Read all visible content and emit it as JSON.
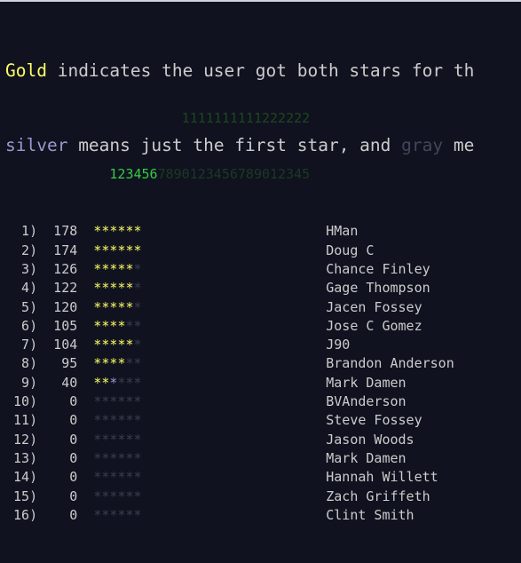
{
  "legend": {
    "line1": [
      {
        "text": "Gold",
        "style": "gold"
      },
      {
        "text": " indicates the user got both stars for th",
        "style": "plain"
      }
    ],
    "line2": [
      {
        "text": "silver",
        "style": "silver"
      },
      {
        "text": " means just the first star, and ",
        "style": "plain"
      },
      {
        "text": "gray",
        "style": "gray"
      },
      {
        "text": " me",
        "style": "plain"
      }
    ],
    "full_text_line1": "Gold indicates the user got both stars for th",
    "full_text_line2": "silver means just the first star, and gray me"
  },
  "column_header": {
    "tens_row": "         1111111111222222",
    "ones_row": "1234567890123456789012345",
    "highlight_count": 6,
    "tens_indent": 9
  },
  "colors": {
    "background": "#10121f",
    "gold": "#ffff66",
    "silver": "#9999cc",
    "gray": "#3b3e52",
    "text": "#cccccc",
    "header_green_bright": "#33cc44",
    "header_green_dim": "#1e4620",
    "top_strip": "#cfd3e0"
  },
  "board": {
    "star_count": 6,
    "rows": [
      {
        "rank": "1)",
        "score": "178",
        "stars": [
          "gold",
          "gold",
          "gold",
          "gold",
          "gold",
          "gold"
        ],
        "name": "HMan"
      },
      {
        "rank": "2)",
        "score": "174",
        "stars": [
          "gold",
          "gold",
          "gold",
          "gold",
          "gold",
          "gold"
        ],
        "name": "Doug C"
      },
      {
        "rank": "3)",
        "score": "126",
        "stars": [
          "gold",
          "gold",
          "gold",
          "gold",
          "gold",
          "gray"
        ],
        "name": "Chance Finley"
      },
      {
        "rank": "4)",
        "score": "122",
        "stars": [
          "gold",
          "gold",
          "gold",
          "gold",
          "gold",
          "gray"
        ],
        "name": "Gage Thompson"
      },
      {
        "rank": "5)",
        "score": "120",
        "stars": [
          "gold",
          "gold",
          "gold",
          "gold",
          "gold",
          "gray"
        ],
        "name": "Jacen Fossey"
      },
      {
        "rank": "6)",
        "score": "105",
        "stars": [
          "gold",
          "gold",
          "gold",
          "gold",
          "gray",
          "gray"
        ],
        "name": "Jose C Gomez"
      },
      {
        "rank": "7)",
        "score": "104",
        "stars": [
          "gold",
          "gold",
          "gold",
          "gold",
          "gold",
          "gray"
        ],
        "name": "J90"
      },
      {
        "rank": "8)",
        "score": "95",
        "stars": [
          "gold",
          "gold",
          "gold",
          "gold",
          "gray",
          "gray"
        ],
        "name": "Brandon Anderson"
      },
      {
        "rank": "9)",
        "score": "40",
        "stars": [
          "gold",
          "gold",
          "silver",
          "gray",
          "gray",
          "gray"
        ],
        "name": "Mark Damen"
      },
      {
        "rank": "10)",
        "score": "0",
        "stars": [
          "gray",
          "gray",
          "gray",
          "gray",
          "gray",
          "gray"
        ],
        "name": "BVAnderson"
      },
      {
        "rank": "11)",
        "score": "0",
        "stars": [
          "gray",
          "gray",
          "gray",
          "gray",
          "gray",
          "gray"
        ],
        "name": "Steve Fossey"
      },
      {
        "rank": "12)",
        "score": "0",
        "stars": [
          "gray",
          "gray",
          "gray",
          "gray",
          "gray",
          "gray"
        ],
        "name": "Jason Woods"
      },
      {
        "rank": "13)",
        "score": "0",
        "stars": [
          "gray",
          "gray",
          "gray",
          "gray",
          "gray",
          "gray"
        ],
        "name": "Mark Damen"
      },
      {
        "rank": "14)",
        "score": "0",
        "stars": [
          "gray",
          "gray",
          "gray",
          "gray",
          "gray",
          "gray"
        ],
        "name": "Hannah Willett"
      },
      {
        "rank": "15)",
        "score": "0",
        "stars": [
          "gray",
          "gray",
          "gray",
          "gray",
          "gray",
          "gray"
        ],
        "name": "Zach Griffeth"
      },
      {
        "rank": "16)",
        "score": "0",
        "stars": [
          "gray",
          "gray",
          "gray",
          "gray",
          "gray",
          "gray"
        ],
        "name": "Clint Smith"
      }
    ]
  }
}
